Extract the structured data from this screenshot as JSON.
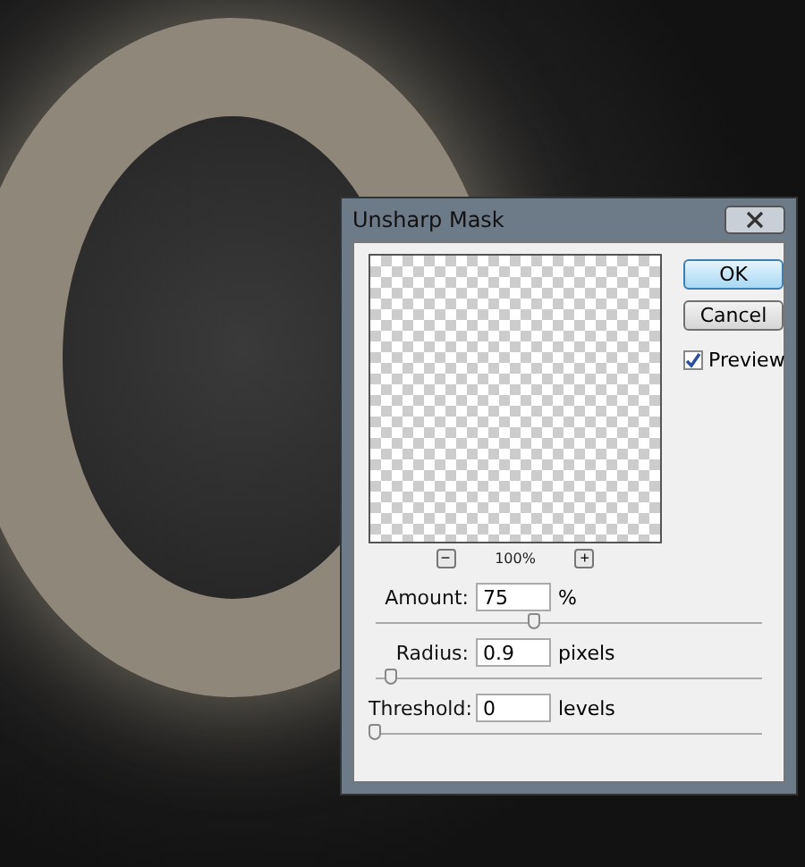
{
  "dialog": {
    "title": "Unsharp Mask",
    "zoom": {
      "minus": "−",
      "plus": "+",
      "value": "100%"
    },
    "buttons": [
      {
        "label": "OK",
        "default": true
      },
      {
        "label": "Cancel",
        "default": false
      }
    ],
    "preview": {
      "label": "Preview",
      "checked": true
    },
    "controls": [
      {
        "label": "Amount:",
        "value": "75",
        "unit": "%",
        "level": 0.41
      },
      {
        "label": "Radius:",
        "value": "0.9",
        "unit": "pixels",
        "level": 0.04
      },
      {
        "label": "Threshold:",
        "value": "0",
        "unit": "levels",
        "level": 0.0
      }
    ]
  }
}
